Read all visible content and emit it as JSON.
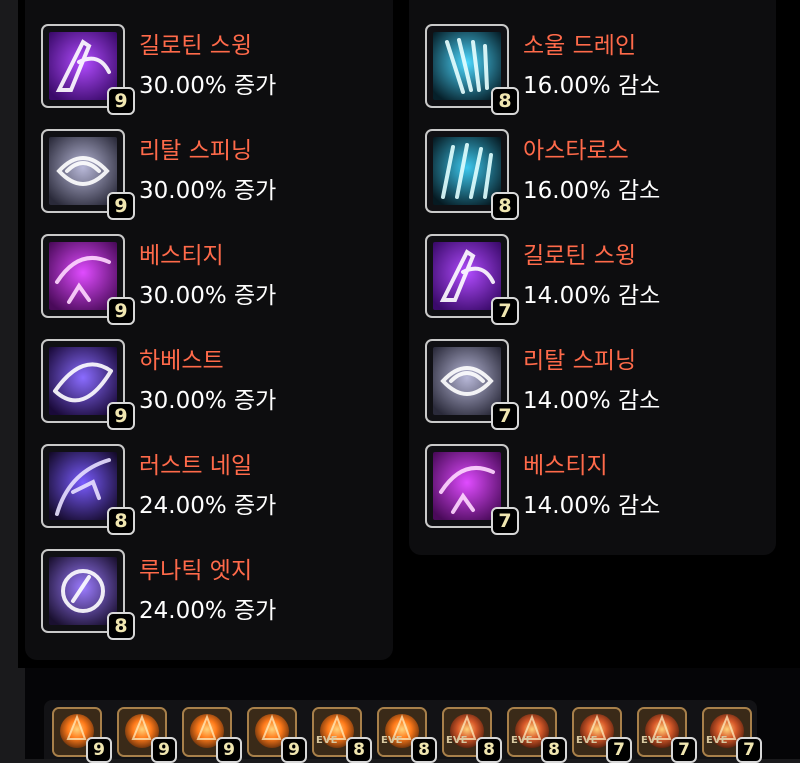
{
  "left_panel": {
    "entries": [
      {
        "name": "길로틴 스윙",
        "value": "30.00% 증가",
        "level": "9",
        "icon": "guillotine-swing-icon",
        "theme": "violet-blade"
      },
      {
        "name": "리탈 스피닝",
        "value": "30.00% 증가",
        "level": "9",
        "icon": "lethal-spinning-icon",
        "theme": "silver-swirl"
      },
      {
        "name": "베스티지",
        "value": "30.00% 증가",
        "level": "9",
        "icon": "vestige-icon",
        "theme": "magenta-burst"
      },
      {
        "name": "하베스트",
        "value": "30.00% 증가",
        "level": "9",
        "icon": "harvest-icon",
        "theme": "violet-ring"
      },
      {
        "name": "러스트 네일",
        "value": "24.00% 증가",
        "level": "8",
        "icon": "lust-nail-icon",
        "theme": "violet-slash"
      },
      {
        "name": "루나틱 엣지",
        "value": "24.00% 증가",
        "level": "8",
        "icon": "lunatic-edge-icon",
        "theme": "violet-swirl"
      }
    ]
  },
  "right_panel": {
    "entries": [
      {
        "name": "소울 드레인",
        "value": "16.00% 감소",
        "level": "8",
        "icon": "soul-drain-icon",
        "theme": "cyan-claw"
      },
      {
        "name": "아스타로스",
        "value": "16.00% 감소",
        "level": "8",
        "icon": "astaroth-icon",
        "theme": "cyan-spikes"
      },
      {
        "name": "길로틴 스윙",
        "value": "14.00% 감소",
        "level": "7",
        "icon": "guillotine-swing-icon",
        "theme": "violet-blade"
      },
      {
        "name": "리탈 스피닝",
        "value": "14.00% 감소",
        "level": "7",
        "icon": "lethal-spinning-icon",
        "theme": "silver-swirl"
      },
      {
        "name": "베스티지",
        "value": "14.00% 감소",
        "level": "7",
        "icon": "vestige-icon",
        "theme": "magenta-burst"
      }
    ]
  },
  "gems": [
    {
      "level": "9",
      "event": "",
      "icon": "damage-gem-icon"
    },
    {
      "level": "9",
      "event": "",
      "icon": "damage-gem-icon"
    },
    {
      "level": "9",
      "event": "",
      "icon": "damage-gem-icon"
    },
    {
      "level": "9",
      "event": "",
      "icon": "damage-gem-icon"
    },
    {
      "level": "8",
      "event": "EVE",
      "icon": "event-damage-gem-icon"
    },
    {
      "level": "8",
      "event": "EVE",
      "icon": "event-damage-gem-icon"
    },
    {
      "level": "8",
      "event": "EVE",
      "icon": "event-cooldown-gem-icon"
    },
    {
      "level": "8",
      "event": "EVE",
      "icon": "event-cooldown-gem-icon"
    },
    {
      "level": "7",
      "event": "EVE",
      "icon": "event-cooldown-gem-icon"
    },
    {
      "level": "7",
      "event": "EVE",
      "icon": "event-cooldown-gem-icon"
    },
    {
      "level": "7",
      "event": "EVE",
      "icon": "event-cooldown-gem-icon"
    }
  ],
  "colors": {
    "skill_name": "#ff6a4a",
    "value_text": "#ffffff",
    "level_text": "#f0e6b0",
    "gem_border": "#a8804a"
  }
}
